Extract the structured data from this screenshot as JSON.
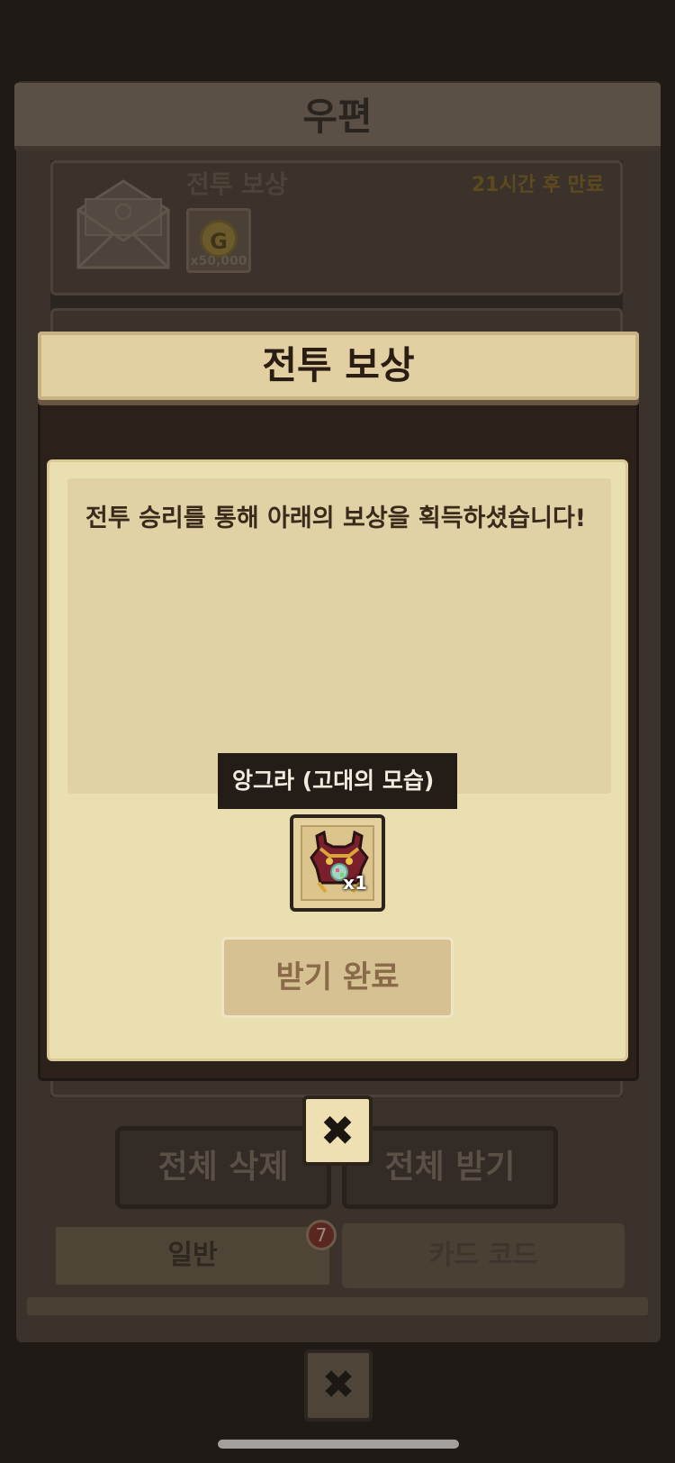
{
  "mail": {
    "title": "우편",
    "card": {
      "title": "전투 보상",
      "expire": "21시간 후 만료",
      "item_qty": "x50,000",
      "item_icon": "G"
    },
    "delete_all": "전체 삭제",
    "receive_all": "전체 받기",
    "tabs": {
      "general": "일반",
      "card_code": "카드 코드",
      "badge_count": "7"
    },
    "close_icon": "✖"
  },
  "dialog": {
    "title": "전투 보상",
    "message": "전투 승리를 통해 아래의 보상을 획득하셨습니다!",
    "tooltip": "앙그라 (고대의 모습)",
    "reward_qty": "x1",
    "received_label": "받기 완료",
    "close_icon": "✖"
  },
  "colors": {
    "dialog_header": "#e2cfa2",
    "dialog_body": "#eadfb1",
    "button_disabled": "#d6c193"
  }
}
